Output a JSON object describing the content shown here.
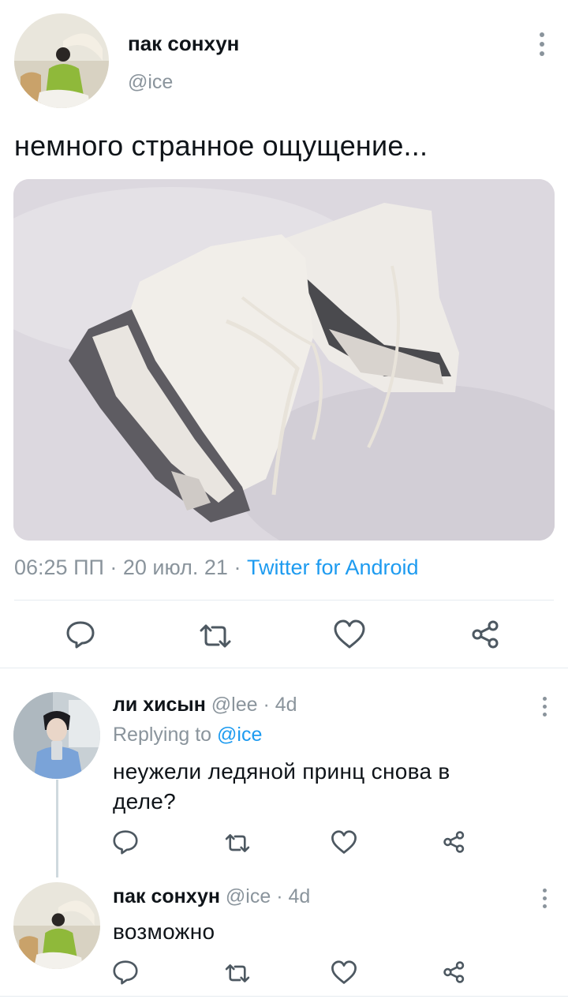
{
  "main_tweet": {
    "author_name": "пак сонхун",
    "author_handle": "@ice",
    "text": "немного странное ощущение...",
    "image_alt_icon": "ice-skates-photo",
    "time": "06:25 ПП",
    "date": "20 июл. 21",
    "source": "Twitter for Android",
    "separator": " · ",
    "actions": [
      "reply-icon",
      "retweet-icon",
      "like-icon",
      "share-icon"
    ]
  },
  "replies": [
    {
      "author_name": "ли хисын",
      "author_handle": "@lee",
      "age": "4d",
      "replying_prefix": "Replying to ",
      "replying_to": "@ice",
      "text": "неужели ледяной принц снова в деле?"
    },
    {
      "author_name": "пак сонхун",
      "author_handle": "@ice",
      "age": "4d",
      "text": "возможно"
    }
  ],
  "colors": {
    "accent": "#1d9bf0",
    "muted": "#8a949c",
    "text": "#0f1419",
    "divider": "#e6ecf0"
  }
}
